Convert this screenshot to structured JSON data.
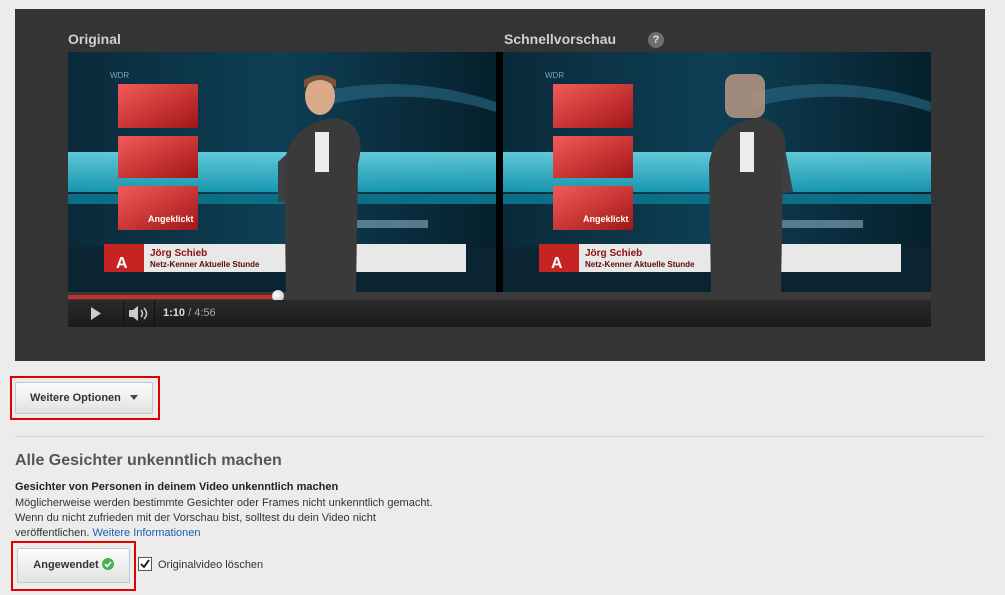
{
  "preview": {
    "original_label": "Original",
    "quick_preview_label": "Schnellvorschau",
    "help_glyph": "?"
  },
  "video": {
    "channel_logo": "WDR",
    "side_label": "Angeklickt",
    "lower_third_letter": "A",
    "presenter_name": "Jörg Schieb",
    "presenter_subtitle": "Netz-Kenner Aktuelle Stunde",
    "current_time": "1:10",
    "duration": "/ 4:56",
    "progress": 0.243
  },
  "options_button": {
    "label": "Weitere Optionen"
  },
  "blur_faces": {
    "heading": "Alle Gesichter unkenntlich machen",
    "subheading": "Gesichter von Personen in deinem Video unkenntlich machen",
    "description_line1": "Möglicherweise werden bestimmte Gesichter oder Frames nicht unkenntlich gemacht.",
    "description_line2": "Wenn du nicht zufrieden mit der Vorschau bist, solltest du dein Video nicht",
    "description_line3": "veröffentlichen.",
    "more_info_link": "Weitere Informationen",
    "applied_button": "Angewendet",
    "delete_original_label": "Originalvideo löschen",
    "delete_original_checked": true
  },
  "colors": {
    "highlight": "#e00000",
    "progress": "#c4302b",
    "link": "#1a5fb4",
    "applied_check": "#4caf50"
  },
  "icons": [
    "play-icon",
    "volume-icon",
    "help-icon",
    "dropdown-arrow-icon",
    "applied-check-icon",
    "checkbox-check-icon"
  ]
}
